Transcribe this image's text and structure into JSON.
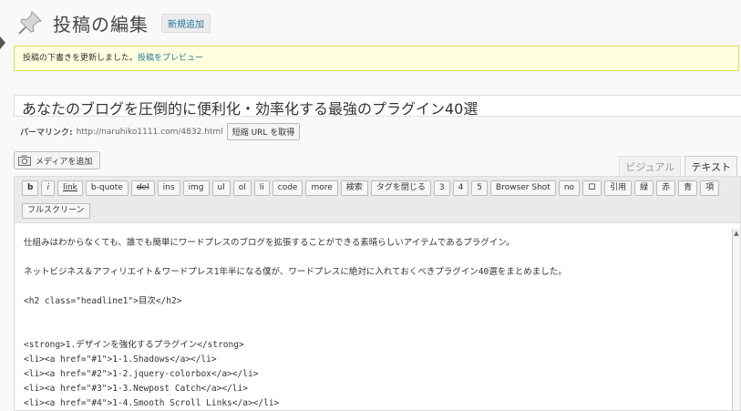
{
  "header": {
    "title": "投稿の編集",
    "add_new_label": "新規追加"
  },
  "notice": {
    "message": "投稿の下書きを更新しました。",
    "preview_link": "投稿をプレビュー"
  },
  "post": {
    "title": "あなたのブログを圧倒的に便利化・効率化する最強のプラグイン40選",
    "permalink_label": "パーマリンク:",
    "permalink_url": "http://naruhiko1111.com/4832.html",
    "shortlink_button": "短縮 URL を取得"
  },
  "media": {
    "add_media_label": "メディアを追加"
  },
  "editor_tabs": [
    {
      "label": "ビジュアル",
      "active": false
    },
    {
      "label": "テキスト",
      "active": true
    }
  ],
  "quicktags_row1": [
    "b",
    "i",
    "link",
    "b-quote",
    "del",
    "ins",
    "img",
    "ul",
    "ol",
    "li",
    "code",
    "more",
    "検索",
    "タグを閉じる",
    "3",
    "4",
    "5",
    "Browser Shot",
    "no",
    "ロ",
    "引用",
    "緑",
    "赤",
    "青",
    "項"
  ],
  "quicktags_row2": [
    "フルスクリーン"
  ],
  "editor_content": [
    "仕組みはわからなくても、誰でも簡単にワードプレスのブログを拡張することができる素晴らしいアイテムであるプラグイン。",
    "",
    "ネットビジネス＆アフィリエイト＆ワードプレス1年半になる僕が、ワードプレスに絶対に入れておくべきプラグイン40選をまとめました。",
    "",
    "<h2 class=\"headline1\">目次</h2>",
    "",
    "",
    "<strong>1.デザインを強化するプラグイン</strong>",
    "<li><a href=\"#1\">1-1.Shadows</a></li>",
    "<li><a href=\"#2\">1-2.jquery-colorbox</a></li>",
    "<li><a href=\"#3\">1-3.Newpost Catch</a></li>",
    "<li><a href=\"#4\">1-4.Smooth Scroll Links</a></li>"
  ],
  "colors": {
    "notice_bg": "#ffffe0",
    "notice_border": "#e6db55",
    "link": "#21759b"
  }
}
